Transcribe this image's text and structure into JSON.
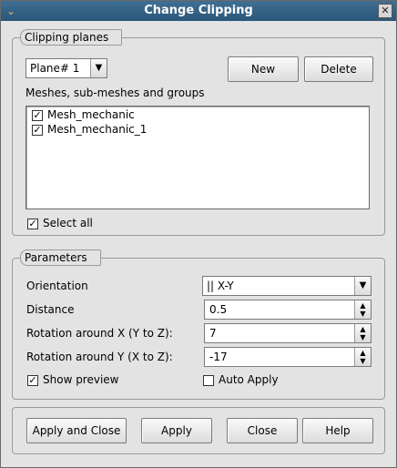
{
  "window": {
    "title": "Change Clipping",
    "menu_icon": "menu-arrow-icon",
    "close_icon": "close-icon"
  },
  "clipping_planes": {
    "group_title": "Clipping planes",
    "plane_select": "Plane# 1",
    "new_label": "New",
    "delete_label": "Delete",
    "meshes_label": "Meshes, sub-meshes and groups",
    "meshes": [
      {
        "label": "Mesh_mechanic",
        "checked": true
      },
      {
        "label": "Mesh_mechanic_1",
        "checked": true
      }
    ],
    "select_all_label": "Select all",
    "select_all_checked": true
  },
  "parameters": {
    "group_title": "Parameters",
    "orientation_label": "Orientation",
    "orientation_value": "|| X-Y",
    "distance_label": "Distance",
    "distance_value": "0.5",
    "rot_x_label": "Rotation around X (Y to Z):",
    "rot_x_value": "7",
    "rot_y_label": "Rotation around Y (X to Z):",
    "rot_y_value": "-17",
    "show_preview_label": "Show preview",
    "show_preview_checked": true,
    "auto_apply_label": "Auto Apply",
    "auto_apply_checked": false
  },
  "buttons": {
    "apply_close": "Apply and Close",
    "apply": "Apply",
    "close": "Close",
    "help": "Help"
  }
}
